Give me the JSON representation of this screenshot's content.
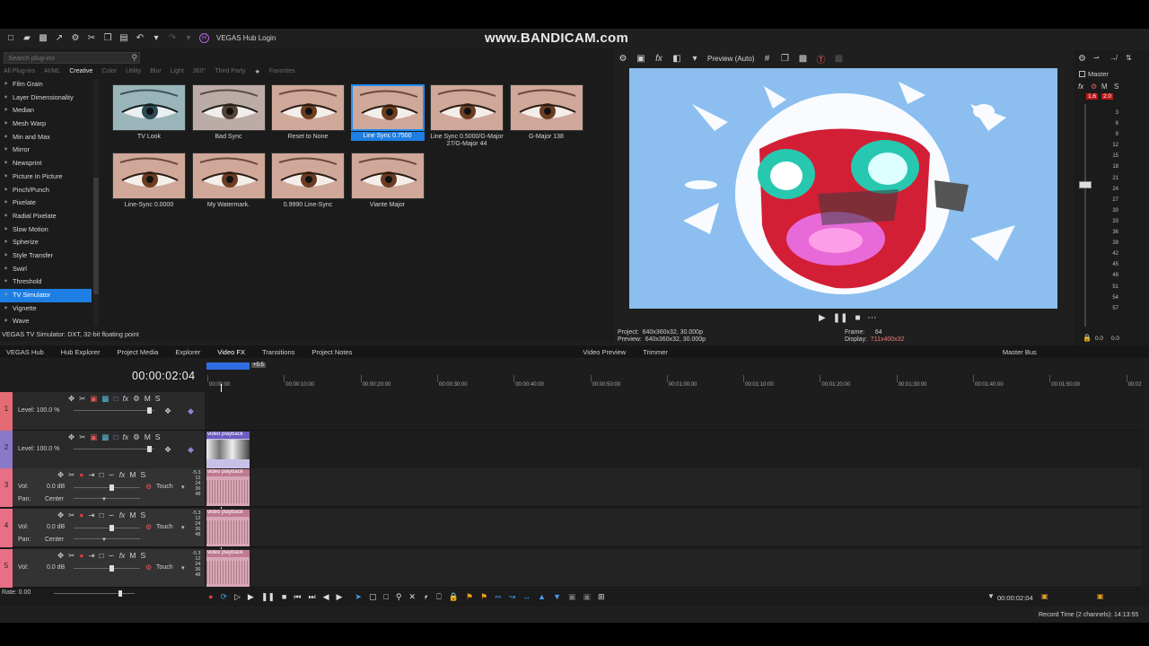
{
  "watermark": "www.BANDICAM.com",
  "hub": {
    "badge": "H",
    "login": "VEGAS Hub Login"
  },
  "plugins": {
    "search_placeholder": "Search plug-ins",
    "category_tabs": [
      "All Plug-ins",
      "AI/ML",
      "Creative",
      "Color",
      "Utility",
      "Blur",
      "Light",
      "360°",
      "Third Party",
      "Favorites"
    ],
    "active_tab": "Creative",
    "fx_list": [
      "Film Grain",
      "Layer Dimensionality",
      "Median",
      "Mesh Warp",
      "Min and Max",
      "Mirror",
      "Newsprint",
      "Picture In Picture",
      "Pinch/Punch",
      "Pixelate",
      "Radial Pixelate",
      "Slow Motion",
      "Spherize",
      "Style Transfer",
      "Swirl",
      "Threshold",
      "TV Simulator",
      "Vignette",
      "Wave"
    ],
    "selected_fx": "TV Simulator",
    "presets": [
      {
        "label": "TV Look"
      },
      {
        "label": "Bad Sync"
      },
      {
        "label": "Reset to None"
      },
      {
        "label": "Line Sync 0.7500",
        "selected": true
      },
      {
        "label": "Line Sync 0.5000/G-Major 27/G-Major 44"
      },
      {
        "label": "G-Major 138"
      },
      {
        "label": "Line-Sync 0.0000"
      },
      {
        "label": "My Watermark."
      },
      {
        "label": "0.9990 Line-Sync"
      },
      {
        "label": "Viante Major"
      }
    ],
    "status": "VEGAS TV Simulator: DXT, 32-bit floating point"
  },
  "preview": {
    "mode": "Preview (Auto)",
    "project_label": "Project:",
    "project_value": "640x360x32, 30.000p",
    "preview_label": "Preview:",
    "preview_value": "640x360x32, 30.000p",
    "frame_label": "Frame:",
    "frame_value": "64",
    "display_label": "Display:",
    "display_value": "711x400x32"
  },
  "master": {
    "title": "Master",
    "peak_left": "1.6",
    "peak_right": "2.0",
    "ticks": [
      "3",
      "6",
      "9",
      "12",
      "15",
      "18",
      "21",
      "24",
      "27",
      "30",
      "33",
      "36",
      "39",
      "42",
      "45",
      "48",
      "51",
      "54",
      "57"
    ],
    "bottom_left": "0.0",
    "bottom_right": "0.0",
    "tab": "Master Bus",
    "fx_label": "fx",
    "m_label": "M",
    "s_label": "S"
  },
  "dock_tabs": [
    "VEGAS Hub",
    "Hub Explorer",
    "Project Media",
    "Explorer",
    "Video FX",
    "Transitions",
    "Project Notes"
  ],
  "preview_tabs": [
    "Video Preview",
    "Trimmer"
  ],
  "timeline": {
    "time_code": "00:00:02:04",
    "ruler_labels": [
      "00:00:00",
      "00:00:10:00",
      "00:00:20:00",
      "00:00:30:00",
      "00:00:40:00",
      "00:00:50:00",
      "00:01:00:00",
      "00:01:10:00",
      "00:01:20:00",
      "00:01:30:00",
      "00:01:40:00",
      "00:01:50:00",
      "00:02"
    ],
    "cursor_marker": "+5:5",
    "tracks": [
      {
        "num": "1",
        "kind": "video",
        "level": "Level: 100.0 %",
        "color": "#e46a74"
      },
      {
        "num": "2",
        "kind": "video",
        "level": "Level: 100.0 %",
        "color": "#8a78c8",
        "clip": "video playback"
      },
      {
        "num": "3",
        "kind": "audio",
        "vol": "Vol:",
        "vol_value": "0.0 dB",
        "pan": "Pan:",
        "pan_value": "Center",
        "touch": "Touch",
        "color": "#e86f86",
        "clip": "video playback"
      },
      {
        "num": "4",
        "kind": "audio",
        "vol": "Vol:",
        "vol_value": "0.0 dB",
        "pan": "Pan:",
        "pan_value": "Center",
        "touch": "Touch",
        "color": "#e86f86",
        "clip": "video playback"
      },
      {
        "num": "5",
        "kind": "audio",
        "vol": "Vol:",
        "vol_value": "0.0 dB",
        "touch": "Touch",
        "color": "#e86f86",
        "clip": "video playback"
      }
    ],
    "rate": "Rate: 0.00",
    "cursor_time": "00:00:02:04",
    "rec_time": "Record Time (2 channels): 14:13:55"
  }
}
